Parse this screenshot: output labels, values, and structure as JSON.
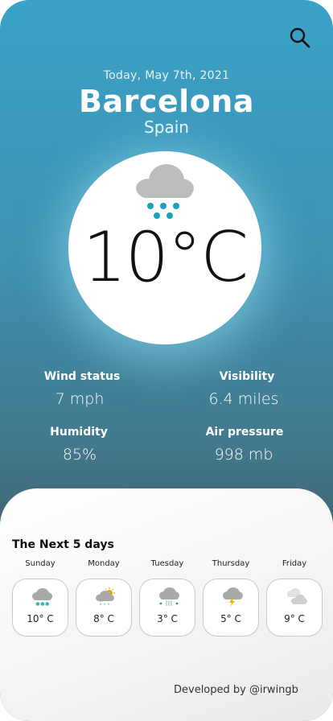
{
  "header": {
    "date": "Today, May 7th, 2021",
    "city": "Barcelona",
    "country": "Spain",
    "search_icon": "search-icon"
  },
  "current": {
    "temperature": "10°C",
    "icon": "cloud-snow-icon"
  },
  "stats": {
    "wind_label": "Wind status",
    "wind_value": "7 mph",
    "visibility_label": "Visibility",
    "visibility_value": "6.4 miles",
    "humidity_label": "Humidity",
    "humidity_value": "85%",
    "pressure_label": "Air pressure",
    "pressure_value": "998 mb"
  },
  "forecast": {
    "title": "The Next 5 days",
    "days": [
      {
        "name": "Sunday",
        "temp": "10° C",
        "icon": "cloud-snow-icon"
      },
      {
        "name": "Monday",
        "temp": "8° C",
        "icon": "sun-cloud-rain-icon"
      },
      {
        "name": "Tuesday",
        "temp": "3° C",
        "icon": "cloud-sleet-icon"
      },
      {
        "name": "Thursday",
        "temp": "5° C",
        "icon": "cloud-lightning-icon"
      },
      {
        "name": "Friday",
        "temp": "9° C",
        "icon": "clouds-icon"
      }
    ]
  },
  "footer": {
    "credit": "Developed by @irwingb"
  },
  "colors": {
    "accent": "#15a3b8",
    "cloud": "#bfbfbf",
    "sun": "#f2a20d",
    "lightning": "#f2b705"
  }
}
